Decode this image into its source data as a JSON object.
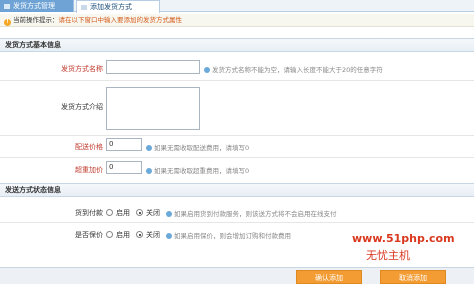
{
  "tabs": {
    "tab1": "发货方式管理",
    "tab2": "添加发货方式"
  },
  "tip": {
    "label": "当前操作提示：",
    "text": "请在以下窗口中输入要添加的发货方式属性"
  },
  "section_basic": {
    "title": "发货方式基本信息",
    "name_label": "发货方式名称",
    "name_value": "",
    "name_hint": "发货方式名称不能为空，请输入长度不能大于20的任意字符",
    "desc_label": "发货方式介绍",
    "desc_value": "",
    "price_label": "配送价格",
    "price_value": "0",
    "price_hint": "如果无需收取配送费用，请填写0",
    "weight_label": "超重加价",
    "weight_value": "0",
    "weight_hint": "如果无需收取超重费用，请填写0"
  },
  "section_status": {
    "title": "发送方式状态信息",
    "cod_label": "货到付款",
    "cod_on": "启用",
    "cod_off": "关闭",
    "cod_selected": "关闭",
    "cod_hint": "如果启用货到付款服务，则该送方式将不会启用在线支付",
    "insure_label": "是否保价",
    "insure_on": "启用",
    "insure_off": "关闭",
    "insure_selected": "关闭",
    "insure_hint": "如果启用保价，则会增加订购和付款费用"
  },
  "buttons": {
    "confirm": "确认添加",
    "cancel": "取消添加"
  },
  "watermark": {
    "line1": "www.51php.com",
    "line2": "无忧主机"
  },
  "colors": {
    "tab_active": "#6fa3d6",
    "required_label": "#c0392b",
    "button": "#f39c33",
    "watermark": "#d9381e"
  }
}
